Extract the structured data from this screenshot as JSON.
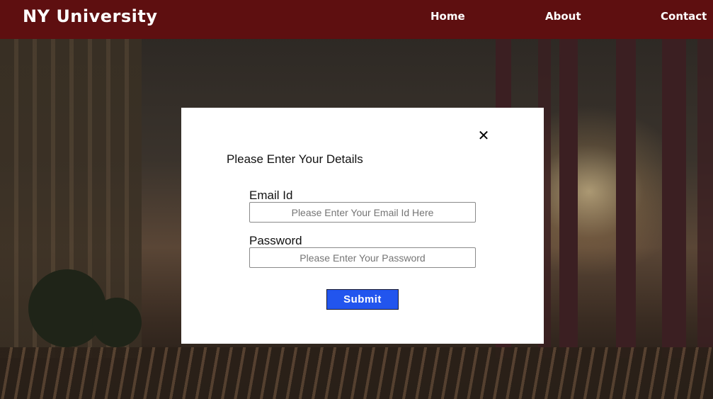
{
  "header": {
    "brand": "NY University",
    "nav": [
      "Home",
      "About",
      "Contact"
    ]
  },
  "modal": {
    "close_glyph": "✕",
    "close_icon": "close-icon",
    "title": "Please Enter Your Details",
    "email": {
      "label": "Email Id",
      "placeholder": "Please Enter Your Email Id Here",
      "value": ""
    },
    "password": {
      "label": "Password",
      "placeholder": "Please Enter Your Password",
      "value": ""
    },
    "submit_label": "Submit"
  },
  "colors": {
    "header_bg": "#5e0f10",
    "submit_bg": "#2255ee",
    "modal_bg": "#ffffff"
  }
}
